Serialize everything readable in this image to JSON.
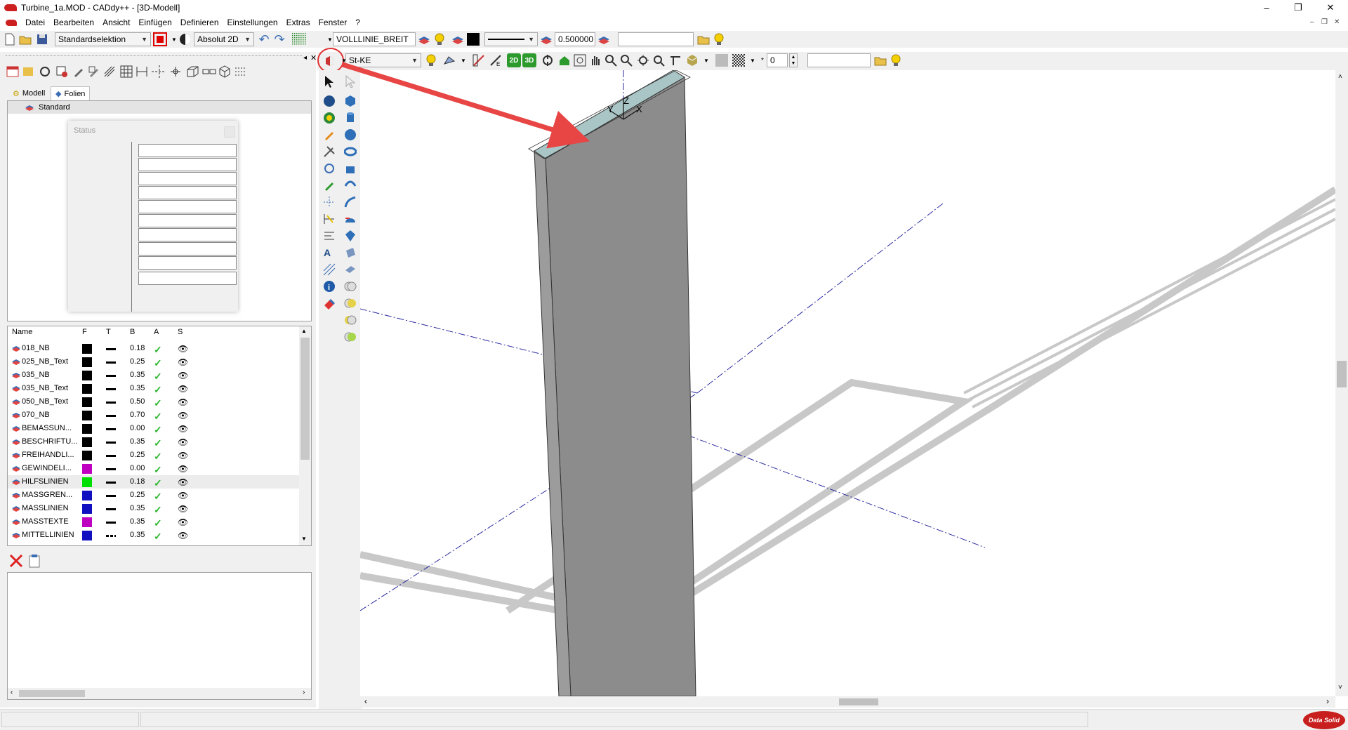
{
  "window": {
    "title": "Turbine_1a.MOD  -  CADdy++ - [3D-Modell]",
    "controls": [
      "–",
      "❐",
      "✕"
    ],
    "mdi_controls": [
      "–",
      "❐",
      "✕"
    ]
  },
  "menu": [
    "Datei",
    "Bearbeiten",
    "Ansicht",
    "Einfügen",
    "Definieren",
    "Einstellungen",
    "Extras",
    "Fenster",
    "?"
  ],
  "toolbar1": {
    "selection_mode": "Standardselektion",
    "coord_mode": "Absolut 2D",
    "line_style": "VOLLLINIE_BREIT",
    "line_width": "0.500000",
    "text_field": ""
  },
  "toolbar2": {
    "material": "St-KE",
    "view_2d": "2D",
    "view_3d": "3D",
    "number": "0",
    "text_field": ""
  },
  "left_panel": {
    "tabs": [
      "Modell",
      "Folien"
    ],
    "tree_item": "Standard",
    "status_dialog": {
      "title": "Status"
    },
    "layer_columns": [
      "Name",
      "F",
      "T",
      "B",
      "A",
      "S"
    ],
    "layers": [
      {
        "name": "018_NB",
        "color": "#000000",
        "width": "0.18",
        "style": "solid"
      },
      {
        "name": "025_NB_Text",
        "color": "#000000",
        "width": "0.25",
        "style": "solid"
      },
      {
        "name": "035_NB",
        "color": "#000000",
        "width": "0.35",
        "style": "solid"
      },
      {
        "name": "035_NB_Text",
        "color": "#000000",
        "width": "0.35",
        "style": "solid"
      },
      {
        "name": "050_NB_Text",
        "color": "#000000",
        "width": "0.50",
        "style": "solid"
      },
      {
        "name": "070_NB",
        "color": "#000000",
        "width": "0.70",
        "style": "solid"
      },
      {
        "name": "BEMASSUN...",
        "color": "#000000",
        "width": "0.00",
        "style": "solid"
      },
      {
        "name": "BESCHRIFTU...",
        "color": "#000000",
        "width": "0.35",
        "style": "solid"
      },
      {
        "name": "FREIHANDLI...",
        "color": "#000000",
        "width": "0.25",
        "style": "solid"
      },
      {
        "name": "GEWINDELI...",
        "color": "#c000c0",
        "width": "0.00",
        "style": "solid"
      },
      {
        "name": "HILFSLINIEN",
        "color": "#00e000",
        "width": "0.18",
        "style": "solid"
      },
      {
        "name": "MASSGREN...",
        "color": "#1010c0",
        "width": "0.25",
        "style": "solid"
      },
      {
        "name": "MASSLINIEN",
        "color": "#1010c0",
        "width": "0.35",
        "style": "solid"
      },
      {
        "name": "MASSTEXTE",
        "color": "#c000c0",
        "width": "0.35",
        "style": "solid"
      },
      {
        "name": "MITTELLINIEN",
        "color": "#1010c0",
        "width": "0.35",
        "style": "dashdot"
      }
    ]
  },
  "viewport": {
    "axis_labels": {
      "y": "Y",
      "z": "Z",
      "x": "X"
    },
    "highlight_color": "#e03030",
    "shape_color": "#8c8c8c",
    "ground_color": "#c8c8c8",
    "centerline_color": "#2a2aa0"
  },
  "status": {
    "brand": "Data Solid"
  }
}
